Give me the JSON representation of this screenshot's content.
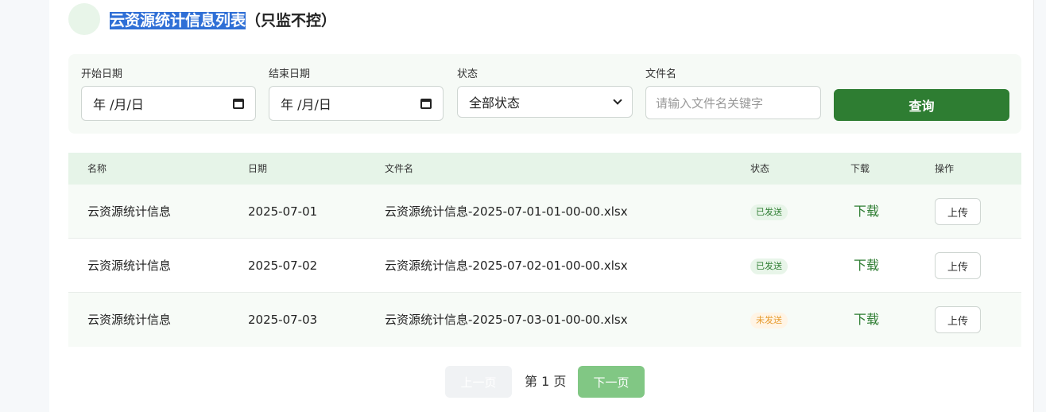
{
  "header": {
    "title_highlight": "云资源统计信息列表",
    "title_suffix": "（只监不控）"
  },
  "filters": {
    "start_date_label": "开始日期",
    "start_date_value": "年 /月/日",
    "end_date_label": "结束日期",
    "end_date_value": "年 /月/日",
    "status_label": "状态",
    "status_value": "全部状态",
    "filename_label": "文件名",
    "filename_placeholder": "请输入文件名关键字",
    "query_label": "查询"
  },
  "table": {
    "columns": [
      "名称",
      "日期",
      "文件名",
      "状态",
      "下载",
      "操作"
    ],
    "rows": [
      {
        "name": "云资源统计信息",
        "date": "2025-07-01",
        "file": "云资源统计信息-2025-07-01-01-00-00.xlsx",
        "status": "已发送",
        "download": "下载",
        "action": "上传"
      },
      {
        "name": "云资源统计信息",
        "date": "2025-07-02",
        "file": "云资源统计信息-2025-07-02-01-00-00.xlsx",
        "status": "已发送",
        "download": "下载",
        "action": "上传"
      },
      {
        "name": "云资源统计信息",
        "date": "2025-07-03",
        "file": "云资源统计信息-2025-07-03-01-00-00.xlsx",
        "status": "未发送",
        "download": "下载",
        "action": "上传"
      }
    ]
  },
  "pagination": {
    "prev_label": "上一页",
    "page_text": "第 1 页",
    "next_label": "下一页"
  },
  "colors": {
    "accent": "#2e7d32",
    "sent_badge": "#e8f5e9",
    "unsent_badge": "#fff4e5"
  }
}
